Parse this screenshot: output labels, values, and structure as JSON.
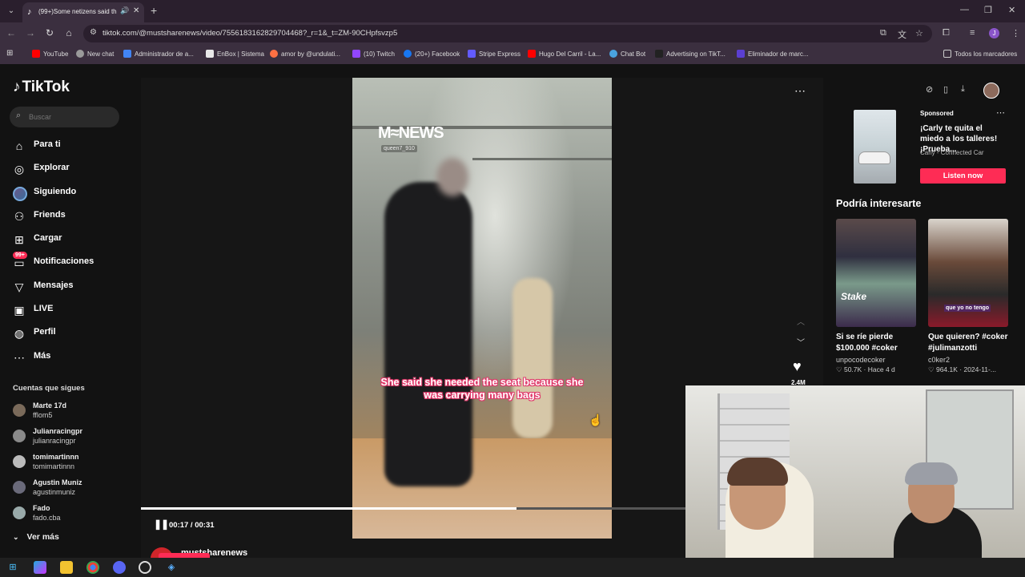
{
  "browser": {
    "tab": {
      "title": "(99+)Some netizens said th",
      "close_label": "✕"
    },
    "url": "tiktok.com/@mustsharenews/video/7556183162829704468?_r=1&_t=ZM-90CHpfsvzp5",
    "bookmarks": [
      {
        "label": "YouTube",
        "color": "#ff0000"
      },
      {
        "label": "New chat",
        "color": "#9a9a9a"
      },
      {
        "label": "Administrador de a...",
        "color": "#4285f4"
      },
      {
        "label": "EnBox | Sistema",
        "color": "#e8e8e8"
      },
      {
        "label": "amor by @undulati...",
        "color": "#ff7043"
      },
      {
        "label": "(10) Twitch",
        "color": "#9146ff"
      },
      {
        "label": "(20+) Facebook",
        "color": "#1877f2"
      },
      {
        "label": "Stripe Express",
        "color": "#635bff"
      },
      {
        "label": "Hugo Del Carril - La...",
        "color": "#ff0000"
      },
      {
        "label": "Chat Bot",
        "color": "#4aa3df"
      },
      {
        "label": "Advertising on TikT...",
        "color": "#222222"
      },
      {
        "label": "Eliminador de marc...",
        "color": "#5b3fd1"
      }
    ],
    "all_bookmarks": "Todos los marcadores"
  },
  "tiktok": {
    "logo": "TikTok",
    "search_placeholder": "Buscar",
    "nav": [
      {
        "label": "Para ti",
        "icon": "home-icon"
      },
      {
        "label": "Explorar",
        "icon": "compass-icon"
      },
      {
        "label": "Siguiendo",
        "icon": "following-avatar-icon"
      },
      {
        "label": "Friends",
        "icon": "friends-icon"
      },
      {
        "label": "Cargar",
        "icon": "upload-icon"
      },
      {
        "label": "Notificaciones",
        "icon": "notifications-icon",
        "badge": "99+"
      },
      {
        "label": "Mensajes",
        "icon": "messages-icon"
      },
      {
        "label": "LIVE",
        "icon": "live-icon"
      },
      {
        "label": "Perfil",
        "icon": "profile-icon"
      },
      {
        "label": "Más",
        "icon": "more-icon"
      }
    ],
    "following_title": "Cuentas que sigues",
    "following": [
      {
        "name": "Marte 17d",
        "handle": "fflom5"
      },
      {
        "name": "Julianracingpr",
        "handle": "julianracingpr"
      },
      {
        "name": "tomimartinnn",
        "handle": "tomimartinnn"
      },
      {
        "name": "Agustin Muniz",
        "handle": "agustinmuniz"
      },
      {
        "name": "Fado",
        "handle": "fado.cba"
      }
    ],
    "see_more": "Ver más"
  },
  "video": {
    "watermark": "M≈NEWS",
    "watermark_user": "queen7_910",
    "caption": "She said she needed the seat because she was carrying many bags",
    "likes": "2.4M",
    "time": "00:17 / 00:31",
    "progress": 0.55,
    "author": "mustsharenews"
  },
  "ad": {
    "sponsored": "Sponsored",
    "title": "¡Carly te quita el miedo a los talleres! ¡Prueba...",
    "brand": "Carly - Connected Car",
    "cta": "Listen now"
  },
  "suggestions": {
    "title": "Podría interesarte",
    "items": [
      {
        "caption": "Si se ríe pierde $100.000 #coker",
        "user": "unpocodecoker",
        "meta": "♡ 50.7K  ·  Hace 4 d",
        "overlay": "Stake"
      },
      {
        "caption": "Que quieren? #coker #julimanzotti",
        "user": "c0ker2",
        "meta": "♡ 964.1K  ·  2024-11-...",
        "overlay": "que yo no tengo"
      }
    ]
  }
}
